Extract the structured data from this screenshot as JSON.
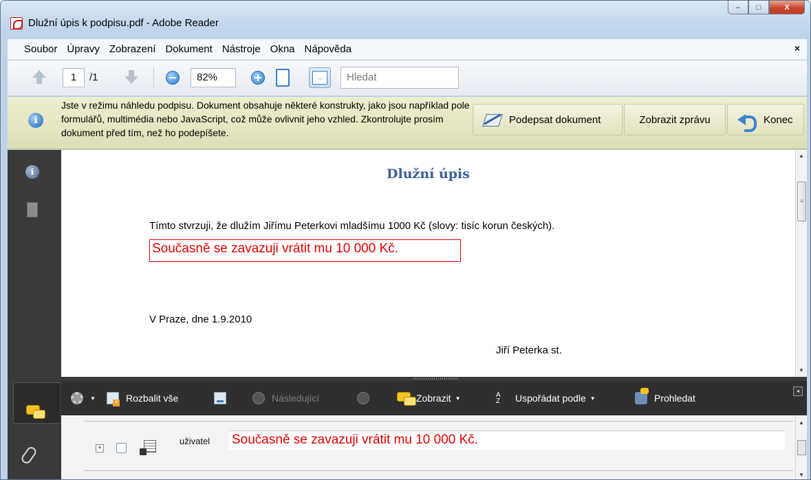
{
  "window": {
    "title": "Dlužní úpis k podpisu.pdf - Adobe Reader",
    "controls": {
      "minimize": "–",
      "maximize": "□",
      "close": "X"
    }
  },
  "menubar": {
    "items": [
      "Soubor",
      "Úpravy",
      "Zobrazení",
      "Dokument",
      "Nástroje",
      "Okna",
      "Nápověda"
    ],
    "close": "×"
  },
  "toolbar": {
    "page_current": "1",
    "page_total": "/1",
    "zoom_value": "82%",
    "search_placeholder": "Hledat"
  },
  "infobar": {
    "message": "Jste v režimu náhledu podpisu. Dokument obsahuje některé konstrukty, jako jsou například pole formulářů, multimédia nebo JavaScript, což může ovlivnit jeho vzhled. Zkontrolujte prosím dokument před tím, než ho podepíšete.",
    "sign_button": "Podepsat dokument",
    "report_button": "Zobrazit zprávu",
    "end_button": "Konec"
  },
  "document": {
    "title": "Dlužní úpis",
    "line1": "Tímto stvrzuji, že dlužím Jiřímu Peterkovi mladšímu 1000 Kč (slovy: tisíc korun českých).",
    "form_field_text": "Současně se zavazuji vrátit mu 10 000 Kč.",
    "date_line": "V Praze, dne 1.9.2010",
    "signature_name": "Jiří Peterka st."
  },
  "comments_panel": {
    "toolbar": {
      "expand_all": "Rozbalit vše",
      "next": "Následující",
      "show": "Zobrazit",
      "sort_by": "Uspořádat podle",
      "search": "Prohledat"
    },
    "entries": [
      {
        "author": "uživatel",
        "text": "Současně se zavazuji vrátit mu 10 000 Kč."
      }
    ]
  },
  "colors": {
    "field_red": "#e00000",
    "doc_title_blue": "#3a6096",
    "infobar_bg": "#e6e6c4",
    "panel_dark": "#2f2f2f"
  }
}
